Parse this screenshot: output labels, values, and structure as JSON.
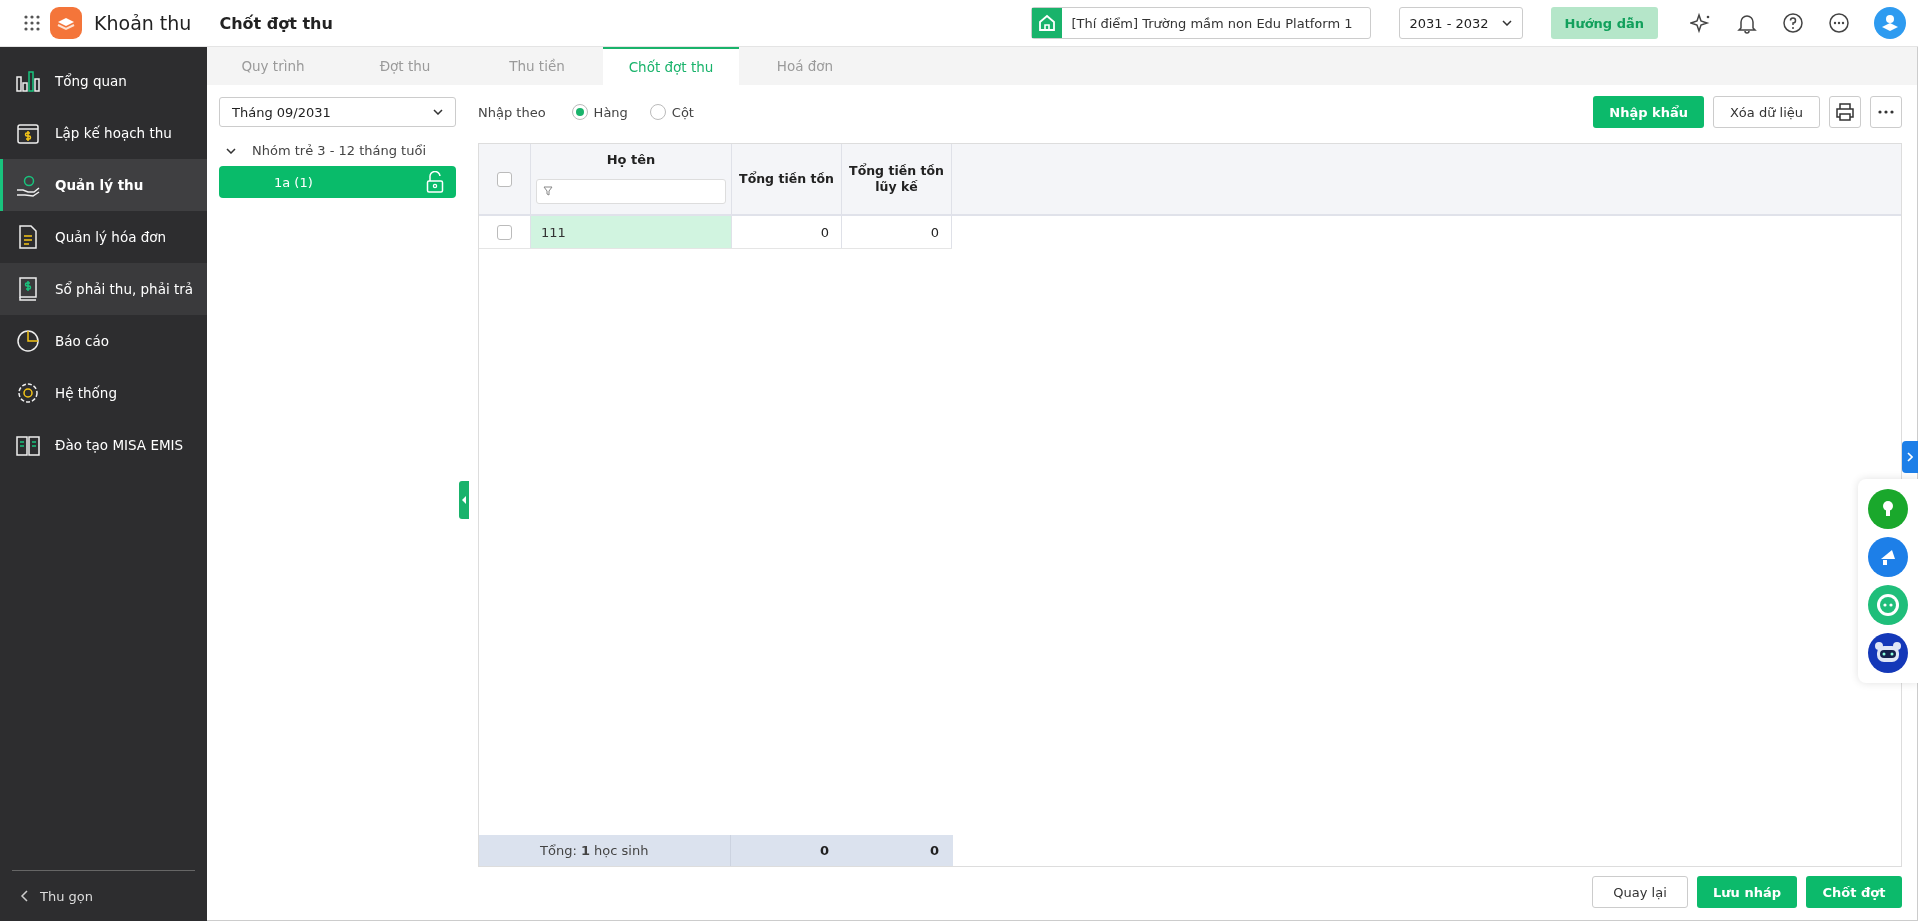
{
  "app": {
    "title": "Khoản thu",
    "page_title": "Chốt đợt thu"
  },
  "header": {
    "school": "[Thí điểm] Trường mầm non Edu Platform 1",
    "year": "2031 - 2032",
    "guide_button": "Hướng dẫn"
  },
  "sidebar": {
    "items": [
      {
        "label": "Tổng quan",
        "selected": false,
        "hovered": false
      },
      {
        "label": "Lập kế hoạch thu",
        "selected": false,
        "hovered": false
      },
      {
        "label": "Quản lý thu",
        "selected": true,
        "hovered": false
      },
      {
        "label": "Quản lý hóa đơn",
        "selected": false,
        "hovered": false
      },
      {
        "label": "Sổ phải thu, phải trả",
        "selected": false,
        "hovered": true
      },
      {
        "label": "Báo cáo",
        "selected": false,
        "hovered": false
      },
      {
        "label": "Hệ thống",
        "selected": false,
        "hovered": false
      },
      {
        "label": "Đào tạo MISA EMIS",
        "selected": false,
        "hovered": false
      }
    ],
    "collapse": "Thu gọn"
  },
  "tabs": [
    {
      "label": "Quy trình",
      "selected": false,
      "disabled": true
    },
    {
      "label": "Đợt thu",
      "selected": false,
      "disabled": true
    },
    {
      "label": "Thu tiền",
      "selected": false,
      "disabled": true
    },
    {
      "label": "Chốt đợt thu",
      "selected": true,
      "disabled": false
    },
    {
      "label": "Hoá đơn",
      "selected": false,
      "disabled": true
    }
  ],
  "month_select": "Tháng 09/2031",
  "tree": [
    {
      "label": "Nhóm trẻ 3 - 12 tháng tuổi",
      "expanded": true,
      "children": [
        {
          "label": "1a (1)",
          "selected": true
        }
      ]
    }
  ],
  "input_mode": {
    "label": "Nhập theo",
    "options": [
      {
        "label": "Hàng",
        "selected": true
      },
      {
        "label": "Cột",
        "selected": false
      }
    ]
  },
  "actions": [
    {
      "label": "Nhập khẩu",
      "kind": "primary"
    },
    {
      "label": "Xóa dữ liệu",
      "kind": "secondary"
    }
  ],
  "table": {
    "columns": [
      "Họ tên",
      "Tổng tiền tồn",
      "Tổng tiền tồn lũy kế"
    ],
    "select_all": false,
    "rows": [
      {
        "checked": false,
        "cells": [
          "111",
          "0",
          "0"
        ]
      }
    ],
    "footer": {
      "label": "Tổng: **1** học sinh",
      "totals": [
        "0",
        "0"
      ]
    }
  },
  "footer_buttons": [
    {
      "label": "Quay lại",
      "kind": "secondary"
    },
    {
      "label": "Lưu nháp",
      "kind": "primary"
    },
    {
      "label": "Chốt đợt",
      "kind": "primary"
    }
  ]
}
